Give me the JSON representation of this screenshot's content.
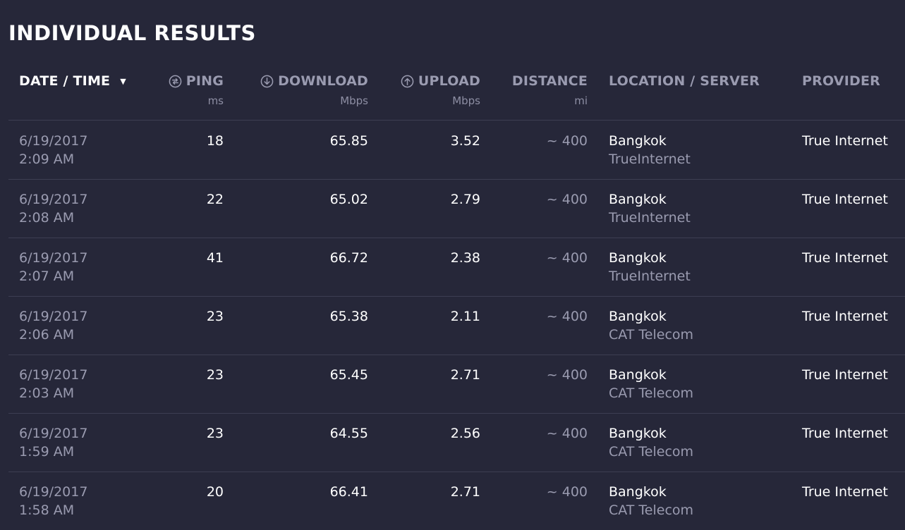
{
  "page_title": "INDIVIDUAL RESULTS",
  "columns": {
    "date": {
      "label": "DATE / TIME"
    },
    "ping": {
      "label": "PING",
      "unit": "ms",
      "icon": "ping-icon"
    },
    "download": {
      "label": "DOWNLOAD",
      "unit": "Mbps",
      "icon": "download-arrow-icon"
    },
    "upload": {
      "label": "UPLOAD",
      "unit": "Mbps",
      "icon": "upload-arrow-icon"
    },
    "distance": {
      "label": "DISTANCE",
      "unit": "mi"
    },
    "location": {
      "label": "LOCATION / SERVER"
    },
    "provider": {
      "label": "PROVIDER"
    }
  },
  "colors": {
    "background": "#262739",
    "muted_text": "#9a9bb0",
    "divider": "#3d3e52"
  },
  "rows": [
    {
      "date": "6/19/2017",
      "time": "2:09 AM",
      "ping": "18",
      "download": "65.85",
      "upload": "3.52",
      "distance": "~ 400",
      "location": "Bangkok",
      "server": "TrueInternet",
      "provider": "True Internet"
    },
    {
      "date": "6/19/2017",
      "time": "2:08 AM",
      "ping": "22",
      "download": "65.02",
      "upload": "2.79",
      "distance": "~ 400",
      "location": "Bangkok",
      "server": "TrueInternet",
      "provider": "True Internet"
    },
    {
      "date": "6/19/2017",
      "time": "2:07 AM",
      "ping": "41",
      "download": "66.72",
      "upload": "2.38",
      "distance": "~ 400",
      "location": "Bangkok",
      "server": "TrueInternet",
      "provider": "True Internet"
    },
    {
      "date": "6/19/2017",
      "time": "2:06 AM",
      "ping": "23",
      "download": "65.38",
      "upload": "2.11",
      "distance": "~ 400",
      "location": "Bangkok",
      "server": "CAT Telecom",
      "provider": "True Internet"
    },
    {
      "date": "6/19/2017",
      "time": "2:03 AM",
      "ping": "23",
      "download": "65.45",
      "upload": "2.71",
      "distance": "~ 400",
      "location": "Bangkok",
      "server": "CAT Telecom",
      "provider": "True Internet"
    },
    {
      "date": "6/19/2017",
      "time": "1:59 AM",
      "ping": "23",
      "download": "64.55",
      "upload": "2.56",
      "distance": "~ 400",
      "location": "Bangkok",
      "server": "CAT Telecom",
      "provider": "True Internet"
    },
    {
      "date": "6/19/2017",
      "time": "1:58 AM",
      "ping": "20",
      "download": "66.41",
      "upload": "2.71",
      "distance": "~ 400",
      "location": "Bangkok",
      "server": "CAT Telecom",
      "provider": "True Internet"
    }
  ]
}
